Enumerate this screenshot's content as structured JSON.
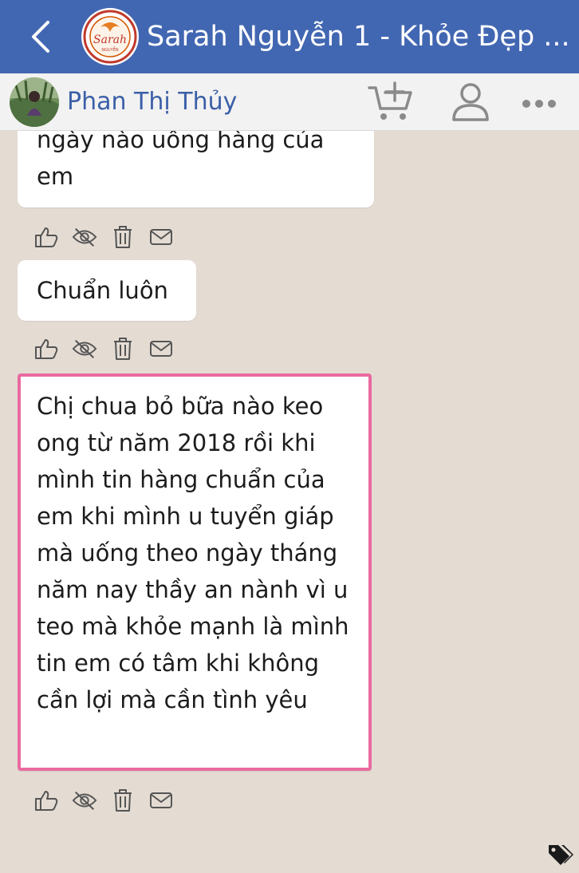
{
  "header": {
    "title": "Sarah Nguyễn 1 - Khỏe Đẹp ...",
    "logo_text": "Sarah",
    "logo_subtext": "NGUYỄN"
  },
  "conversation": {
    "user_name": "Phan Thị Thủy"
  },
  "messages": [
    {
      "text": "ngày nào uống  hàng của em"
    },
    {
      "text": "Chuẩn luôn"
    },
    {
      "text": "Chị chua bỏ bữa nào keo ong từ  năm 2018 rồi khi mình tin hàng chuẩn của em khi mình u tuyển giáp mà uống theo ngày tháng năm nay thầy an nành vì u teo mà khỏe mạnh là mình tin em có tâm khi không cần lợi mà cần  tình yêu"
    }
  ],
  "colors": {
    "header_bg": "#4267b2",
    "highlight_border": "#ea6aa0",
    "chat_bg": "#e4dcd3",
    "user_name": "#3b5fa8"
  },
  "icons": {
    "back": "chevron-left-icon",
    "cart": "cart-plus-icon",
    "profile": "person-icon",
    "more": "more-dots-icon",
    "like": "thumbs-up-icon",
    "hide": "eye-slash-icon",
    "delete": "trash-icon",
    "message": "envelope-icon",
    "tags": "tags-icon"
  }
}
